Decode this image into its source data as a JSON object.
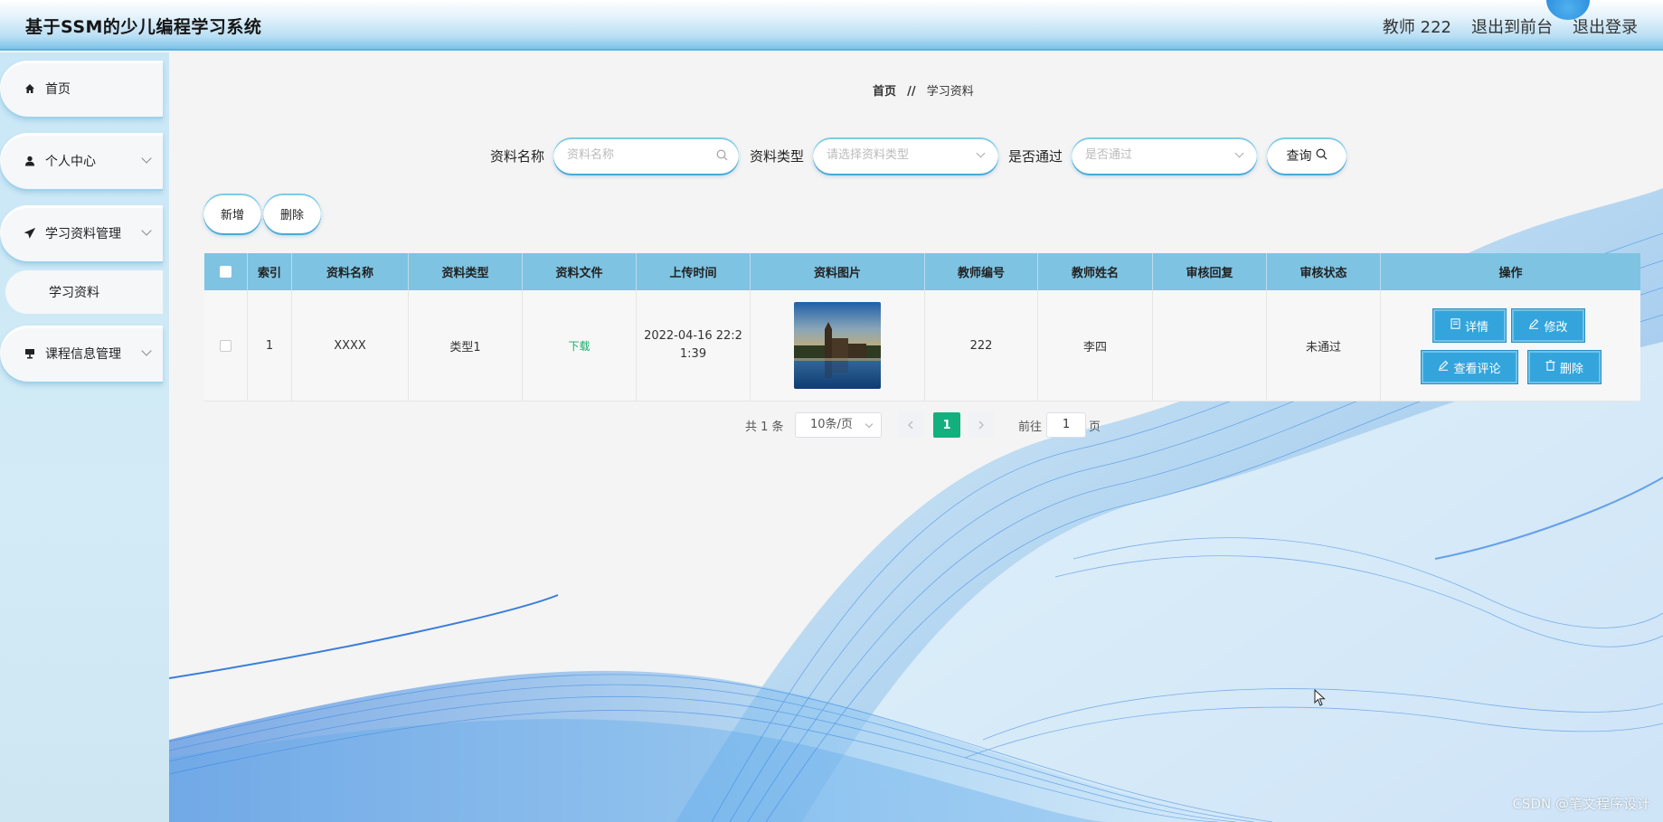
{
  "header": {
    "title": "基于SSM的少儿编程学习系统",
    "user": "教师 222",
    "to_front": "退出到前台",
    "logout": "退出登录"
  },
  "sidebar": {
    "items": [
      {
        "label": "首页",
        "icon": "home-icon"
      },
      {
        "label": "个人中心",
        "icon": "user-icon"
      },
      {
        "label": "学习资料管理",
        "icon": "paper-plane-icon"
      },
      {
        "label": "学习资料"
      },
      {
        "label": "课程信息管理",
        "icon": "board-icon"
      }
    ]
  },
  "breadcrumb": {
    "home": "首页",
    "separator": "//",
    "current": "学习资料"
  },
  "search": {
    "name_label": "资料名称",
    "name_placeholder": "资料名称",
    "type_label": "资料类型",
    "type_placeholder": "请选择资料类型",
    "pass_label": "是否通过",
    "pass_placeholder": "是否通过",
    "query_label": "查询"
  },
  "actions": {
    "add": "新增",
    "delete": "删除"
  },
  "table": {
    "headers": [
      "索引",
      "资料名称",
      "资料类型",
      "资料文件",
      "上传时间",
      "资料图片",
      "教师编号",
      "教师姓名",
      "审核回复",
      "审核状态",
      "操作"
    ],
    "rows": [
      {
        "index": "1",
        "name": "XXXX",
        "type": "类型1",
        "file": "下载",
        "upload_time": "2022-04-16 22:21:39",
        "teacher_no": "222",
        "teacher_name": "李四",
        "reply": "",
        "status": "未通过",
        "ops": {
          "detail": "详情",
          "edit": "修改",
          "comments": "查看评论",
          "delete": "删除"
        }
      }
    ]
  },
  "pagination": {
    "total": "共 1 条",
    "page_size": "10条/页",
    "current_page": "1",
    "goto_label": "前往",
    "goto_value": "1",
    "page_unit": "页"
  },
  "watermark": "CSDN @笔文程序设计",
  "colors": {
    "accent": "#33a5dc",
    "table_header": "#7ec3e2",
    "pager_active": "#12b07c",
    "link_green": "#13ae6b"
  }
}
